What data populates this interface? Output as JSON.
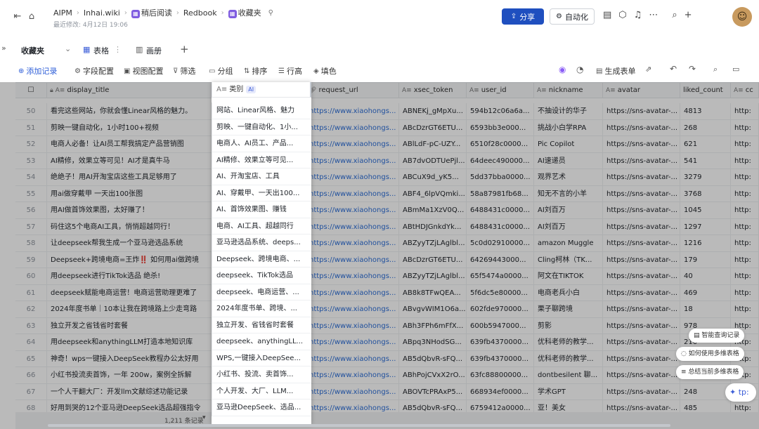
{
  "topbar": {
    "crumbs": [
      "AIPM",
      "Inhai.wiki",
      "稍后阅读",
      "Redbook",
      "收藏夹"
    ],
    "subtitle": "最近修改: 4月12日 19:06",
    "share": "分享",
    "automation": "自动化"
  },
  "viewbar": {
    "table_name": "收藏夹",
    "tabs": [
      {
        "icon": "grid-icon",
        "label": "表格"
      },
      {
        "icon": "gallery-icon",
        "label": "画册"
      }
    ],
    "add": "+"
  },
  "toolbar": {
    "add_record": "添加记录",
    "field_config": "字段配置",
    "view_config": "视图配置",
    "filter": "筛选",
    "group": "分组",
    "sort": "排序",
    "row_height": "行高",
    "fill": "填色",
    "generate_form": "生成表单"
  },
  "columns": [
    "display_title",
    "类别",
    "request_url",
    "xsec_token",
    "user_id",
    "nickname",
    "avatar",
    "liked_count",
    "cc"
  ],
  "category_tag": "AI",
  "rows": [
    {
      "n": "50",
      "title": "看完这些网站，你就会懂Linear风格的魅力。",
      "cat": "网站、Linear风格、魅力",
      "url": "https://www.xiaohongs...",
      "token": "ABNEKj_gMpXu...",
      "uid": "594b12c06a6a...",
      "nick": "不抽设计的华子",
      "avatar": "https://sns-avatar-...",
      "liked": "4813",
      "cc": "http:"
    },
    {
      "n": "51",
      "title": "剪映一键自动化，1小时100+视频",
      "cat": "剪映、一键自动化、1小...",
      "url": "https://www.xiaohongs...",
      "token": "ABcDzrGT6ETU...",
      "uid": "6593bb3e000...",
      "nick": "挑战小白学RPA",
      "avatar": "https://sns-avatar-...",
      "liked": "268",
      "cc": "http:"
    },
    {
      "n": "52",
      "title": "电商人必备！让AI员工帮我搞定产品营销图",
      "cat": "电商人、AI员工、产品...",
      "url": "https://www.xiaohongs...",
      "token": "ABlLdF-pC-UZY...",
      "uid": "6510f28c0000...",
      "nick": "Pic Copilot",
      "avatar": "https://sns-avatar-...",
      "liked": "621",
      "cc": "http:"
    },
    {
      "n": "53",
      "title": "AI精修，效果立等可见！AI才是真牛马",
      "cat": "AI精修、效果立等可见...",
      "url": "https://www.xiaohongs...",
      "token": "AB7dvODTUePjl...",
      "uid": "64deec490000...",
      "nick": "AI速递员",
      "avatar": "https://sns-avatar-...",
      "liked": "541",
      "cc": "http:"
    },
    {
      "n": "54",
      "title": "绝绝子！用AI开淘宝店这些工具足够用了",
      "cat": "AI、开淘宝店、工具",
      "url": "https://www.xiaohongs...",
      "token": "ABCuX9d_yK5...",
      "uid": "5dd37bba0000...",
      "nick": "观界艺术",
      "avatar": "https://sns-avatar-...",
      "liked": "3279",
      "cc": "http:"
    },
    {
      "n": "55",
      "title": "用ai做穿戴甲 一天出100张图",
      "cat": "AI、穿戴甲、一天出100...",
      "url": "https://www.xiaohongs...",
      "token": "ABF4_6lpVQmki...",
      "uid": "58a87981fb68...",
      "nick": "知无不言的小羊",
      "avatar": "https://sns-avatar-...",
      "liked": "3768",
      "cc": "http:"
    },
    {
      "n": "56",
      "title": "用AI做首饰效果图，太好赚了！",
      "cat": "AI、首饰效果图、赚钱",
      "url": "https://www.xiaohongs...",
      "token": "ABmMa1XzV0Q...",
      "uid": "6488431c0000...",
      "nick": "AI刘百万",
      "avatar": "https://sns-avatar-...",
      "liked": "1045",
      "cc": "http:"
    },
    {
      "n": "57",
      "title": "码住这5个电商AI工具，悄悄超越同行！",
      "cat": "电商、AI工具、超越同行",
      "url": "https://www.xiaohongs...",
      "token": "ABtHDJGnkdYk...",
      "uid": "6488431c0000...",
      "nick": "AI刘百万",
      "avatar": "https://sns-avatar-...",
      "liked": "1297",
      "cc": "http:"
    },
    {
      "n": "58",
      "title": "让deepseek帮我生成一个亚马逊选品系统",
      "cat": "亚马逊选品系统、deeps...",
      "url": "https://www.xiaohongs...",
      "token": "ABZyyTZjLAglbl...",
      "uid": "5c0d02910000...",
      "nick": "amazon Muggle",
      "avatar": "https://sns-avatar-...",
      "liked": "1216",
      "cc": "http:"
    },
    {
      "n": "59",
      "title": "Deepseek+跨境电商=王炸‼️ 如何用ai做跨境",
      "cat": "Deepseek、跨境电商、...",
      "url": "https://www.xiaohongs...",
      "token": "ABcDzrGT6ETU...",
      "uid": "64269443000...",
      "nick": "Cling柯林（TK...",
      "avatar": "https://sns-avatar-...",
      "liked": "179",
      "cc": "http:"
    },
    {
      "n": "60",
      "title": "用deepseek进行TikTok选品 绝杀!",
      "cat": "deepseek、TikTok选品",
      "url": "https://www.xiaohongs...",
      "token": "ABZyyTZjLAglbl...",
      "uid": "65f5474a0000...",
      "nick": "阿文在TIKTOK",
      "avatar": "https://sns-avatar-...",
      "liked": "40",
      "cc": "http:"
    },
    {
      "n": "61",
      "title": "deepseek赋能电商运营！电商运营助理更难了",
      "cat": "deepseek、电商运营、...",
      "url": "https://www.xiaohongs...",
      "token": "AB8k8TFwQEA...",
      "uid": "5f6dc5e80000...",
      "nick": "电商老兵小白",
      "avatar": "https://sns-avatar-...",
      "liked": "469",
      "cc": "http:"
    },
    {
      "n": "62",
      "title": "2024年度书单｜10本让我在跨境路上少走弯路",
      "cat": "2024年度书单、跨境、...",
      "url": "https://www.xiaohongs...",
      "token": "ABvgvWIM1O6a...",
      "uid": "602fde970000...",
      "nick": "栗子聊跨境",
      "avatar": "https://sns-avatar-...",
      "liked": "18",
      "cc": "http:"
    },
    {
      "n": "63",
      "title": "独立开发之省钱省时套餐",
      "cat": "独立开发、省钱省时套餐",
      "url": "https://www.xiaohongs...",
      "token": "ABh3FPh6mFfX...",
      "uid": "600b5947000...",
      "nick": "剪影",
      "avatar": "https://sns-avatar-...",
      "liked": "978",
      "cc": "http:"
    },
    {
      "n": "64",
      "title": "用deepseek和anythingLLM打造本地知识库",
      "cat": "deepseek、anythingLL...",
      "url": "https://www.xiaohongs...",
      "token": "ABpq3NHodSG...",
      "uid": "639fb4370000...",
      "nick": "优科老师的教学...",
      "avatar": "https://sns-avatar-...",
      "liked": "210",
      "cc": "http:"
    },
    {
      "n": "65",
      "title": "神奇！wps一键接入DeepSeek教程办公太好用",
      "cat": "WPS,一键接入DeepSee...",
      "url": "https://www.xiaohongs...",
      "token": "AB5dQbvR-sFQ...",
      "uid": "639fb4370000...",
      "nick": "优科老师的教学...",
      "avatar": "https://sns-avatar-...",
      "liked": "",
      "cc": "http:"
    },
    {
      "n": "66",
      "title": "小红书投流卖首饰，一年 200w，案例全拆解",
      "cat": "小红书、投流、卖首饰...",
      "url": "https://www.xiaohongs...",
      "token": "ABhPojCVxX2rO...",
      "uid": "63fc88800000...",
      "nick": "dontbesilent 聊...",
      "avatar": "https://sns-avatar-...",
      "liked": "",
      "cc": "http:"
    },
    {
      "n": "67",
      "title": "一个人干翻大厂：开发llm文献综述功能记录",
      "cat": "个人开发、大厂、LLM...",
      "url": "https://www.xiaohongs...",
      "token": "ABOVTcPRAxP5...",
      "uid": "668934ef0000...",
      "nick": "学术GPT",
      "avatar": "https://sns-avatar-...",
      "liked": "248",
      "cc": "tp:"
    },
    {
      "n": "68",
      "title": "好用到哭的12个亚马逊DeepSeek选品超强指令",
      "cat": "亚马逊DeepSeek、选品...",
      "url": "https://www.xiaohongs...",
      "token": "AB5dQbvR-sFQ...",
      "uid": "6759412a0000...",
      "nick": "亚！美女",
      "avatar": "https://sns-avatar-...",
      "liked": "485",
      "cc": "http:"
    }
  ],
  "footer": {
    "count": "1,211 条记录"
  },
  "floating": {
    "smart_query": "智能查询记录",
    "how_to": "如何使用多维表格",
    "summarize": "总结当前多维表格",
    "corner": "tp:"
  }
}
